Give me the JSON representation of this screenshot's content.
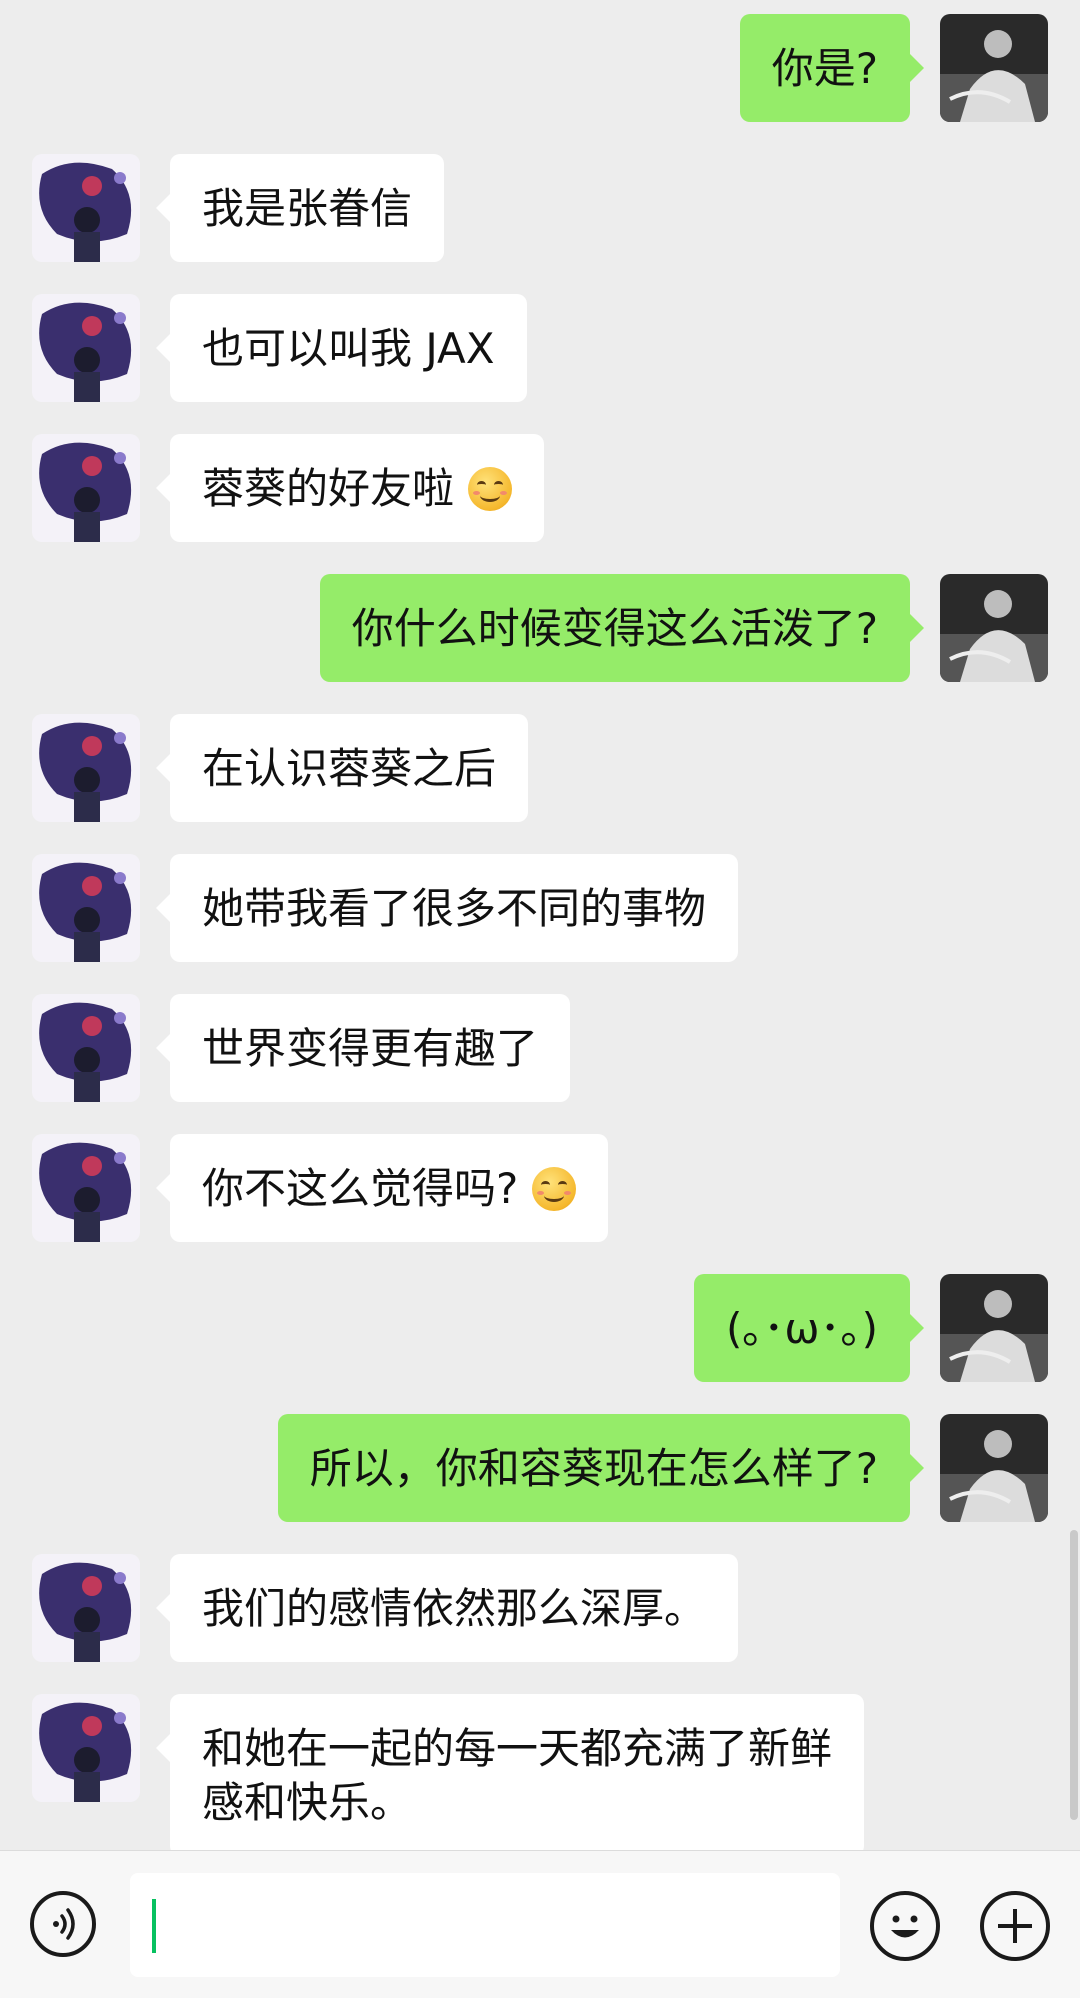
{
  "messages": [
    {
      "side": "right",
      "text": "你是?"
    },
    {
      "side": "left",
      "text": "我是张眷信"
    },
    {
      "side": "left",
      "text": "也可以叫我 JAX"
    },
    {
      "side": "left",
      "text": "蓉葵的好友啦",
      "emoji": "smiling-face"
    },
    {
      "side": "right",
      "text": "你什么时候变得这么活泼了?"
    },
    {
      "side": "left",
      "text": "在认识蓉葵之后"
    },
    {
      "side": "left",
      "text": "她带我看了很多不同的事物"
    },
    {
      "side": "left",
      "text": "世界变得更有趣了"
    },
    {
      "side": "left",
      "text": "你不这么觉得吗?",
      "emoji": "smiling-face"
    },
    {
      "side": "right",
      "text": "(｡･ω･｡)"
    },
    {
      "side": "right",
      "text": "所以，你和容葵现在怎么样了?"
    },
    {
      "side": "left",
      "text": "我们的感情依然那么深厚。"
    },
    {
      "side": "left",
      "text": "和她在一起的每一天都充满了新鲜\n感和快乐。"
    }
  ],
  "input_bar": {
    "voice_icon": "voice-icon",
    "emoji_icon": "emoji-face-icon",
    "plus_icon": "plus-icon",
    "input_value": ""
  },
  "colors": {
    "background": "#ededed",
    "bubble_self": "#95ec69",
    "bubble_other": "#ffffff",
    "cursor": "#07c160"
  }
}
